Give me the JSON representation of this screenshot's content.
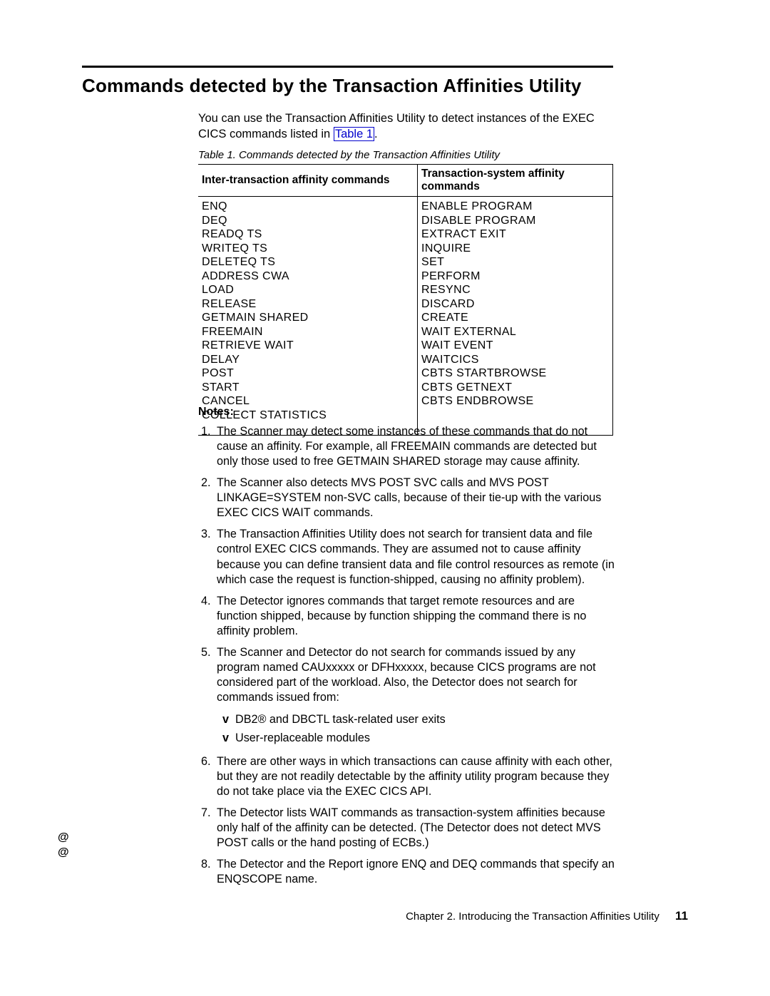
{
  "heading": "Commands detected by the Transaction Affinities Utility",
  "intro_before_link": "You can use the Transaction Affinities Utility to detect instances of the EXEC CICS commands listed in ",
  "intro_link_text": "Table 1",
  "intro_after_link": ".",
  "table_caption": "Table 1. Commands detected by the Transaction Affinities Utility",
  "table": {
    "col1_header": "Inter-transaction affinity commands",
    "col2_header": "Transaction-system affinity commands",
    "col1_body": "ENQ\nDEQ\nREADQ  TS\nWRITEQ  TS\nDELETEQ  TS\nADDRESS  CWA\nLOAD\nRELEASE\nGETMAIN  SHARED\nFREEMAIN\nRETRIEVE  WAIT\nDELAY\nPOST\nSTART\nCANCEL\nCOLLECT  STATISTICS",
    "col2_body": "ENABLE  PROGRAM\nDISABLE  PROGRAM\nEXTRACT  EXIT\nINQUIRE\nSET\nPERFORM\nRESYNC\nDISCARD\nCREATE\nWAIT  EXTERNAL\nWAIT  EVENT\nWAITCICS\nCBTS  STARTBROWSE\nCBTS  GETNEXT\nCBTS  ENDBROWSE"
  },
  "notes_heading": "Notes:",
  "notes": [
    "The Scanner may detect some instances of these commands that do not cause an affinity. For example, all FREEMAIN commands are detected but only those used to free GETMAIN SHARED storage may cause affinity.",
    "The Scanner also detects MVS POST SVC calls and MVS POST LINKAGE=SYSTEM non-SVC calls, because of their tie-up with the various EXEC CICS WAIT commands.",
    "The Transaction Affinities Utility does not search for transient data and file control EXEC CICS commands. They are assumed not to cause affinity because you can define transient data and file control resources as remote (in which case the request is function-shipped, causing no affinity problem).",
    "The Detector ignores commands that target remote resources and are function shipped, because by function shipping the command there is no affinity problem.",
    "The Scanner and Detector do not search for commands issued by any program named CAUxxxxx or DFHxxxxx, because CICS programs are not considered part of the workload. Also, the Detector does not search for commands issued from:",
    "There are other ways in which transactions can cause affinity with each other, but they are not readily detectable by the affinity utility program because they do not take place via the EXEC CICS API.",
    "The Detector lists WAIT commands as transaction-system affinities because only half of the affinity can be detected. (The Detector does not detect MVS POST calls or the hand posting of ECBs.)",
    "The Detector and the Report ignore ENQ and DEQ commands that specify an ENQSCOPE name."
  ],
  "note5_sub": [
    "DB2® and DBCTL task-related user exits",
    "User-replaceable modules"
  ],
  "at_marks": "@\n@",
  "footer_chapter": "Chapter 2. Introducing the Transaction Affinities Utility",
  "footer_page": "11"
}
